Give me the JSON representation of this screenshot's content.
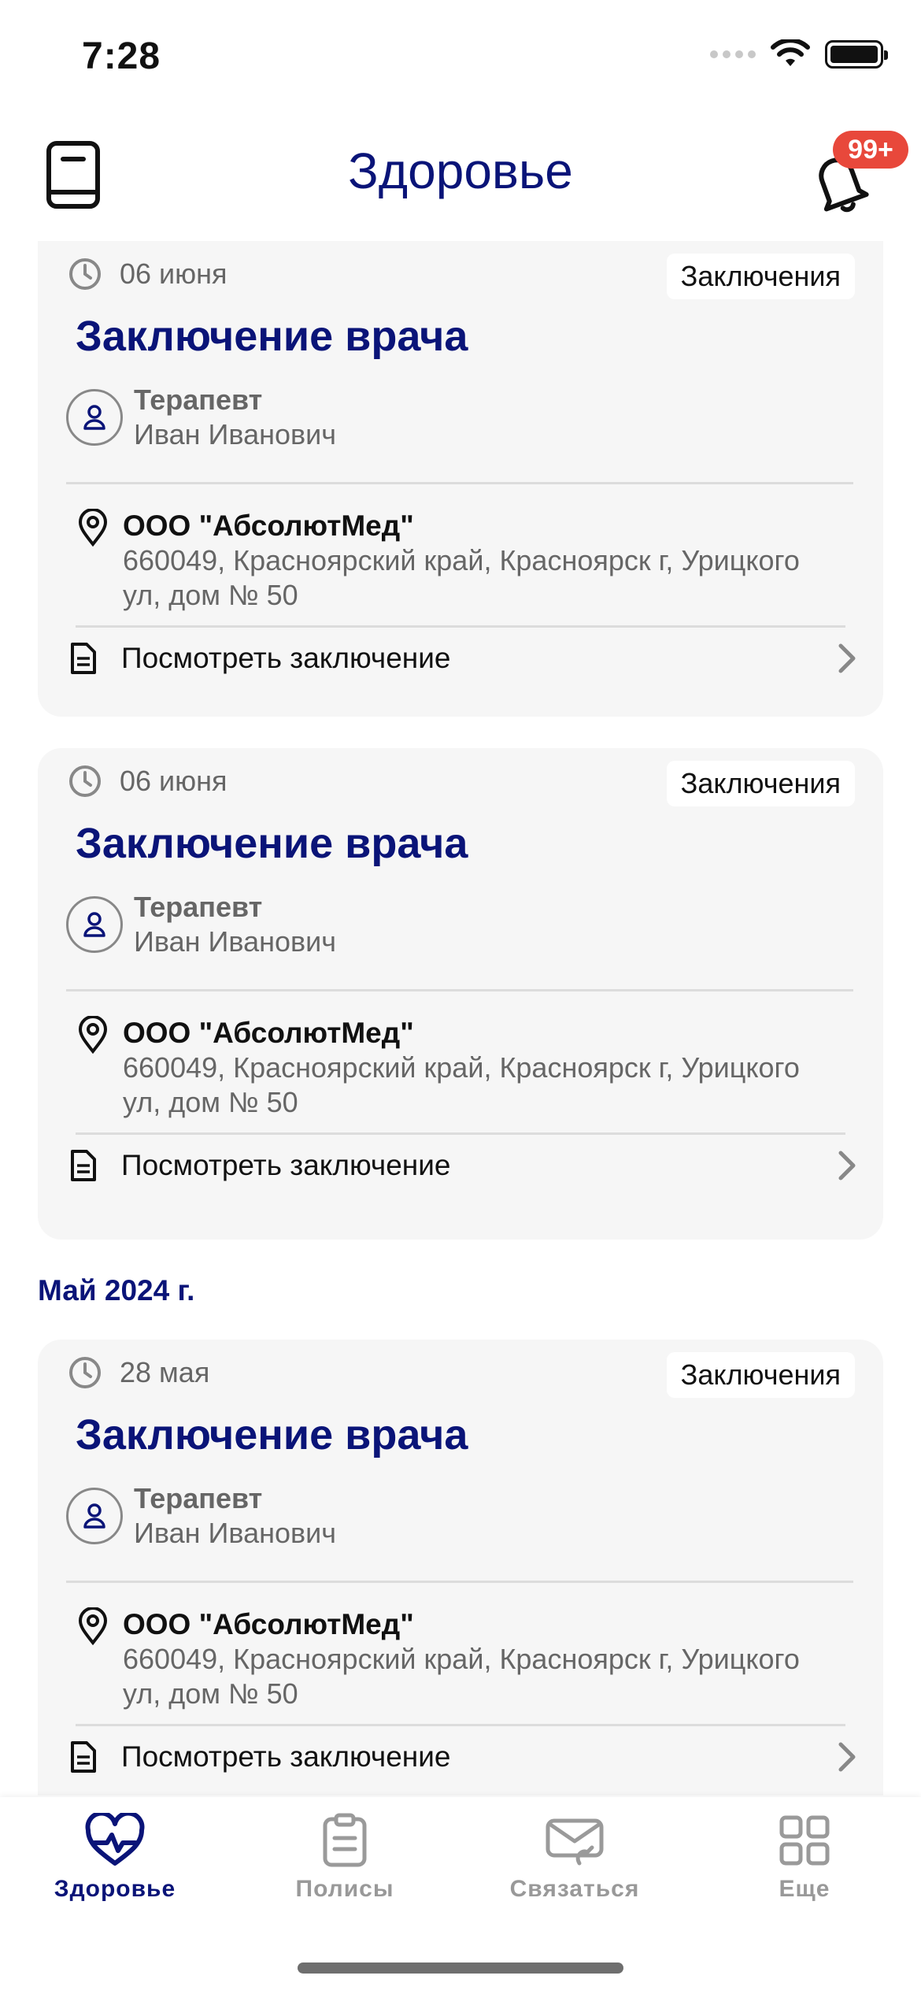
{
  "status_bar": {
    "time": "7:28"
  },
  "header": {
    "title": "Здоровье",
    "notification_badge": "99+"
  },
  "section_may": "Май 2024 г.",
  "cards": [
    {
      "date": "06 июня",
      "tag": "Заключения",
      "title": "Заключение врача",
      "doctor_role": "Терапевт",
      "doctor_name": "Иван Иванович",
      "clinic_name": "ООО \"АбсолютМед\"",
      "clinic_address": "660049, Красноярский край, Красноярск г, Урицкого ул, дом № 50",
      "action": "Посмотреть заключение"
    },
    {
      "date": "06 июня",
      "tag": "Заключения",
      "title": "Заключение врача",
      "doctor_role": "Терапевт",
      "doctor_name": "Иван Иванович",
      "clinic_name": "ООО \"АбсолютМед\"",
      "clinic_address": "660049, Красноярский край, Красноярск г, Урицкого ул, дом № 50",
      "action": "Посмотреть заключение"
    },
    {
      "date": "28 мая",
      "tag": "Заключения",
      "title": "Заключение врача",
      "doctor_role": "Терапевт",
      "doctor_name": "Иван Иванович",
      "clinic_name": "ООО \"АбсолютМед\"",
      "clinic_address": "660049, Красноярский край, Красноярск г, Урицкого ул, дом № 50",
      "action": "Посмотреть заключение"
    }
  ],
  "tabbar": {
    "items": [
      {
        "label": "Здоровье",
        "icon": "heart-pulse-icon",
        "active": true
      },
      {
        "label": "Полисы",
        "icon": "clipboard-icon",
        "active": false
      },
      {
        "label": "Связаться",
        "icon": "phone-mail-icon",
        "active": false
      },
      {
        "label": "Еще",
        "icon": "grid-icon",
        "active": false
      }
    ]
  },
  "colors": {
    "accent": "#0a1478",
    "badge": "#e8483b",
    "card_bg": "#f6f6f6"
  }
}
